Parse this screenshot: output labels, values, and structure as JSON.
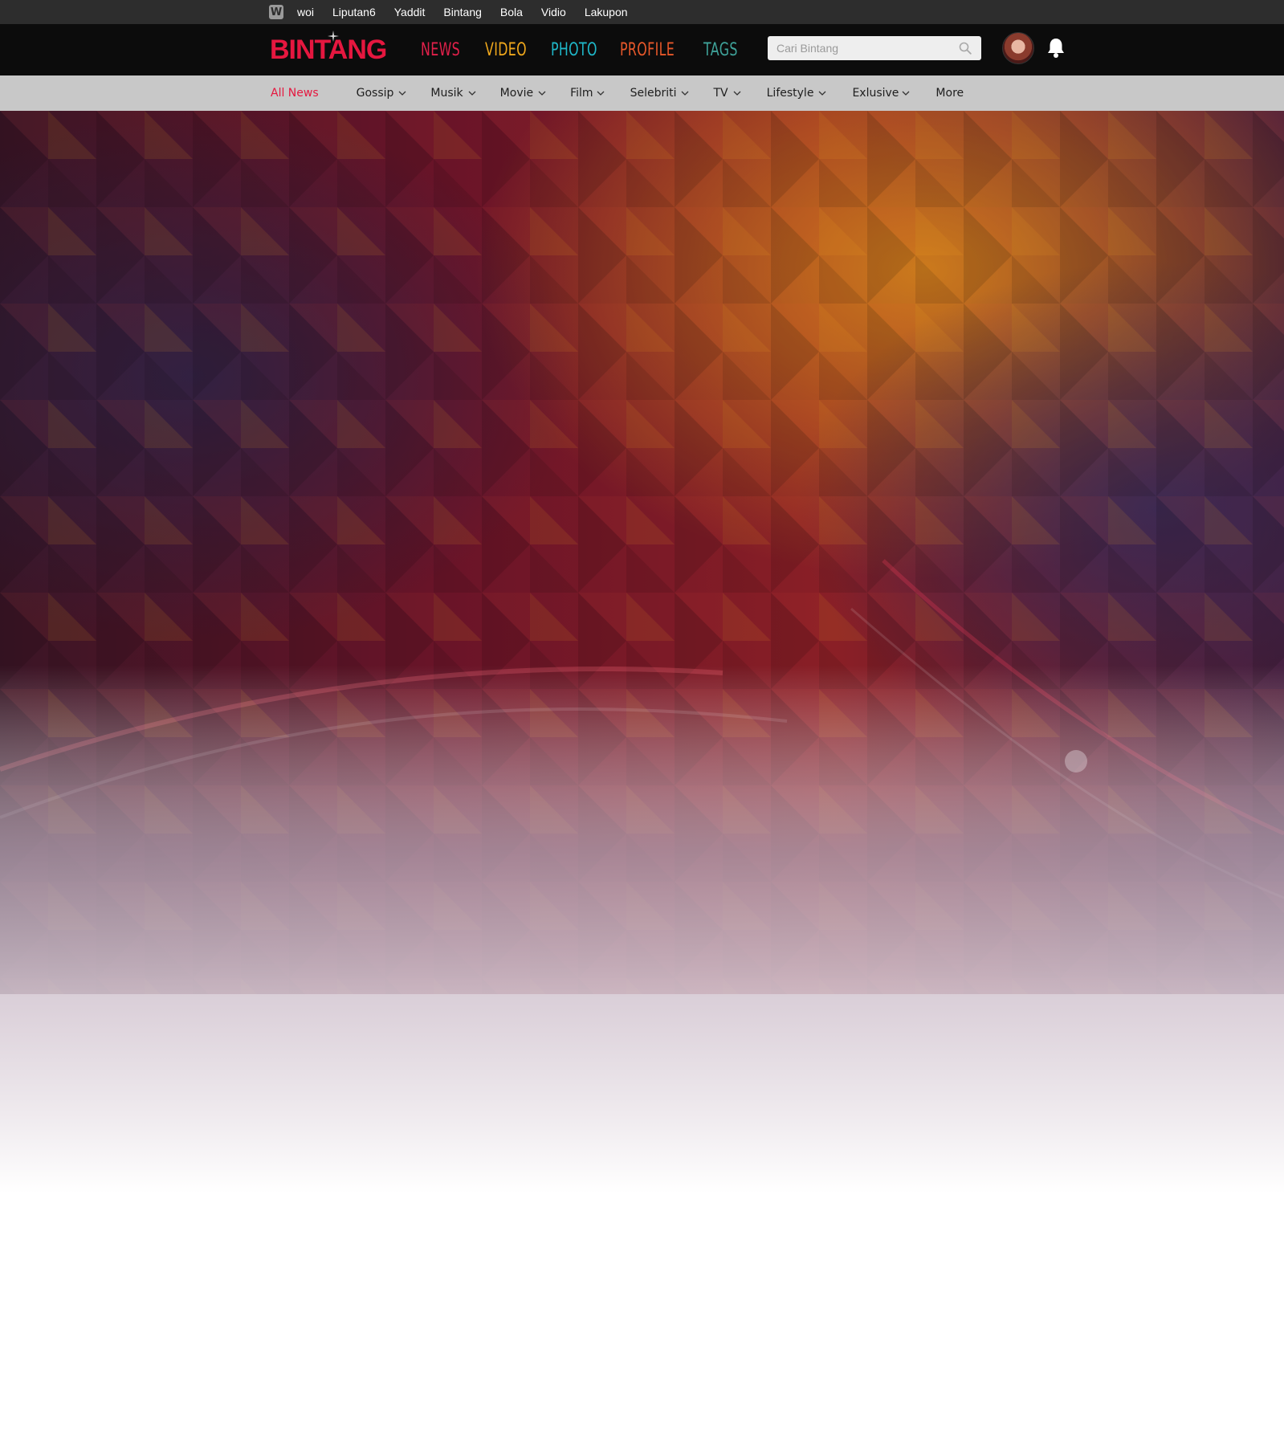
{
  "network_bar": {
    "logo_glyph": "W",
    "links": [
      "woi",
      "Liputan6",
      "Yaddit",
      "Bintang",
      "Bola",
      "Vidio",
      "Lakupon"
    ]
  },
  "header": {
    "brand": "BINTANG",
    "nav": [
      {
        "label": "NEWS",
        "color": "#e0204a"
      },
      {
        "label": "VIDEO",
        "color": "#f0a81c"
      },
      {
        "label": "PHOTO",
        "color": "#1fb8c9"
      },
      {
        "label": "PROFILE",
        "color": "#e8582a"
      },
      {
        "label": "TAGS",
        "color": "#3fa39a"
      }
    ],
    "search": {
      "placeholder": "Cari Bintang",
      "value": ""
    },
    "icons": {
      "search": "search-icon",
      "notifications": "bell-icon",
      "profile": "avatar"
    }
  },
  "category_bar": {
    "items": [
      {
        "label": "All News",
        "dropdown": false,
        "active": true
      },
      {
        "label": "Gossip",
        "dropdown": true,
        "active": false
      },
      {
        "label": "Musik",
        "dropdown": true,
        "active": false
      },
      {
        "label": "Movie",
        "dropdown": true,
        "active": false
      },
      {
        "label": "Film",
        "dropdown": true,
        "active": false
      },
      {
        "label": "Selebriti",
        "dropdown": true,
        "active": false
      },
      {
        "label": "TV",
        "dropdown": true,
        "active": false
      },
      {
        "label": "Lifestyle",
        "dropdown": true,
        "active": false
      },
      {
        "label": "Exlusive",
        "dropdown": true,
        "active": false
      },
      {
        "label": "More",
        "dropdown": false,
        "active": false
      }
    ],
    "active_color": "#e5173f"
  },
  "colors": {
    "brand": "#e5173f",
    "topbar_bg": "#2d2d2d",
    "header_bg": "#0c0c0c",
    "catbar_bg": "#c8c8c8"
  }
}
